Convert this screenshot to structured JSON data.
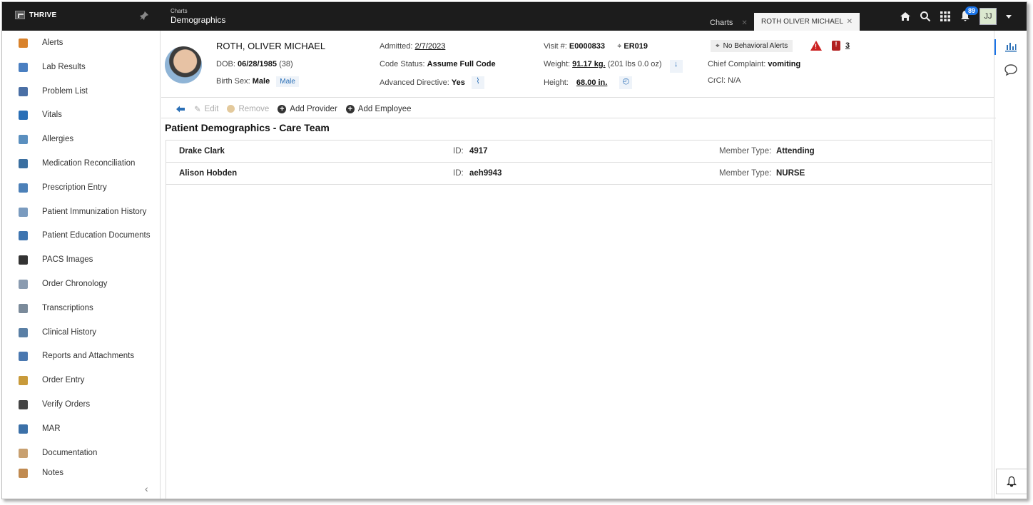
{
  "app": {
    "logo_text": "THRIVE",
    "breadcrumb_small": "Charts",
    "breadcrumb_title": "Demographics",
    "tabs": [
      {
        "label": "Charts"
      },
      {
        "label": "ROTH OLIVER MICHAEL"
      }
    ],
    "notification_count": "89",
    "user_initials": "JJ"
  },
  "sidebar": {
    "items": [
      {
        "label": "Alerts",
        "color": "#d9822b"
      },
      {
        "label": "Lab Results",
        "color": "#4a7fc1"
      },
      {
        "label": "Problem List",
        "color": "#4a6fa5"
      },
      {
        "label": "Vitals",
        "color": "#2a6fb6"
      },
      {
        "label": "Allergies",
        "color": "#5a8fbf"
      },
      {
        "label": "Medication Reconciliation",
        "color": "#3b6fa0"
      },
      {
        "label": "Prescription Entry",
        "color": "#4c80b8"
      },
      {
        "label": "Patient Immunization History",
        "color": "#7a9bbf"
      },
      {
        "label": "Patient Education Documents",
        "color": "#3e75b0"
      },
      {
        "label": "PACS Images",
        "color": "#333333"
      },
      {
        "label": "Order Chronology",
        "color": "#8a9bb0"
      },
      {
        "label": "Transcriptions",
        "color": "#7a8a9a"
      },
      {
        "label": "Clinical History",
        "color": "#5a7fa5"
      },
      {
        "label": "Reports and Attachments",
        "color": "#4a78b0"
      },
      {
        "label": "Order Entry",
        "color": "#c89a3a"
      },
      {
        "label": "Verify Orders",
        "color": "#444444"
      },
      {
        "label": "MAR",
        "color": "#3b70a8"
      },
      {
        "label": "Documentation",
        "color": "#c8a070"
      },
      {
        "label": "Notes",
        "color": "#c08a50"
      }
    ]
  },
  "patient": {
    "last_name": "ROTH",
    "first_names": "OLIVER MICHAEL",
    "dob_label": "DOB:",
    "dob": "06/28/1985",
    "age": "(38)",
    "birth_sex_label": "Birth Sex:",
    "birth_sex": "Male",
    "sex_chip": "Male",
    "admitted_label": "Admitted:",
    "admitted": "2/7/2023",
    "code_status_label": "Code Status:",
    "code_status": "Assume Full Code",
    "adv_directive_label": "Advanced Directive:",
    "adv_directive": "Yes",
    "visit_label": "Visit #:",
    "visit": "E0000833",
    "location": "ER019",
    "weight_label": "Weight:",
    "weight": "91.17 kg.",
    "weight_alt": "(201 lbs 0.0 oz)",
    "height_label": "Height:",
    "height": "68.00 in.",
    "behavioral_alerts": "No Behavioral Alerts",
    "alert_count": "3",
    "chief_complaint_label": "Chief Complaint:",
    "chief_complaint": "vomiting",
    "crcl_label": "CrCl:",
    "crcl": "N/A"
  },
  "toolbar": {
    "edit": "Edit",
    "remove": "Remove",
    "add_provider": "Add Provider",
    "add_employee": "Add Employee"
  },
  "section_title": "Patient Demographics - Care Team",
  "care_team": {
    "id_label": "ID:",
    "member_type_label": "Member Type:",
    "rows": [
      {
        "name": "Drake Clark",
        "id": "4917",
        "member_type": "Attending"
      },
      {
        "name": "Alison Hobden",
        "id": "aeh9943",
        "member_type": "NURSE"
      }
    ]
  }
}
